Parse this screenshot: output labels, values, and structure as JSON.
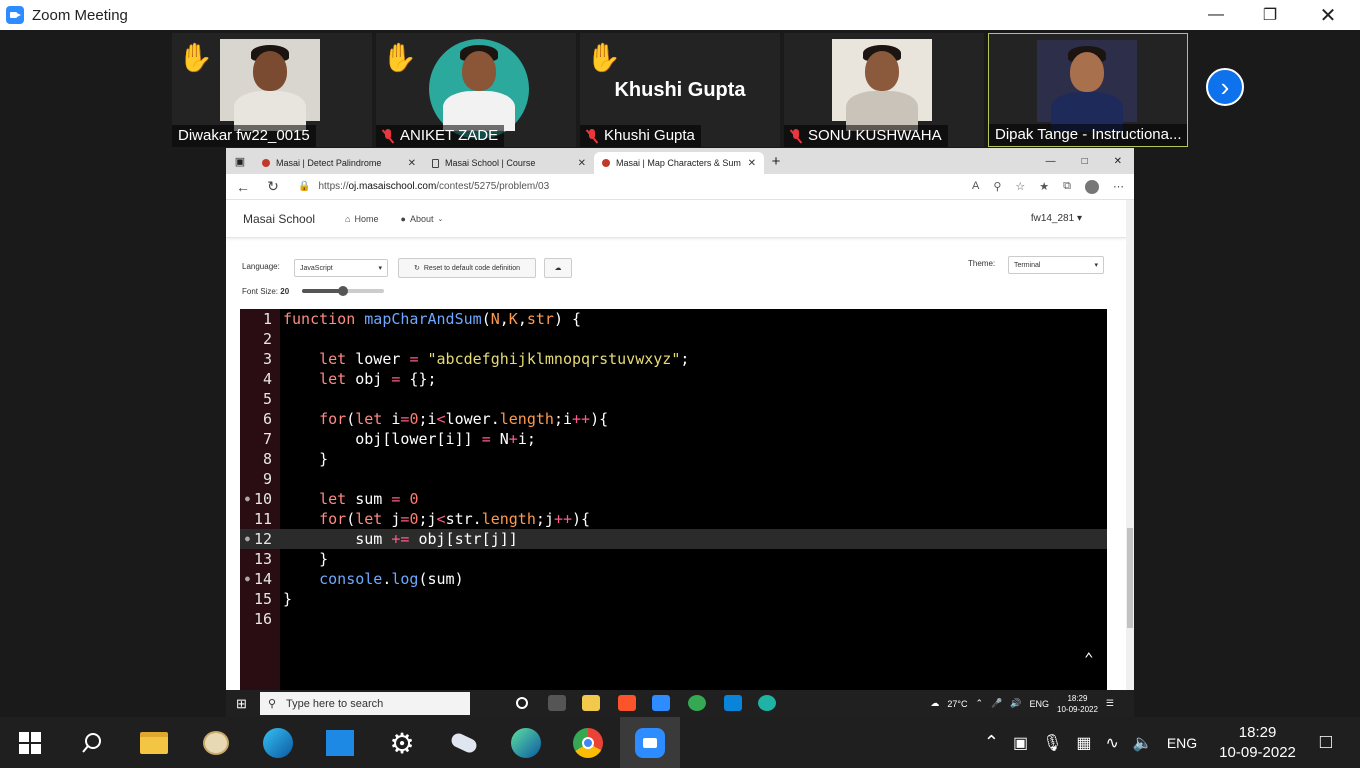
{
  "zoom": {
    "title": "Zoom Meeting",
    "participants": [
      {
        "name": "Diwakar fw22_0015",
        "hand_raised": true,
        "muted": false,
        "video": true
      },
      {
        "name": "ANIKET ZADE",
        "hand_raised": true,
        "muted": true,
        "video": true
      },
      {
        "name": "Khushi Gupta",
        "display_text": "Khushi Gupta",
        "hand_raised": true,
        "muted": true,
        "video": false
      },
      {
        "name": "SONU KUSHWAHA",
        "hand_raised": false,
        "muted": true,
        "video": true
      },
      {
        "name": "Dipak Tange - Instructiona...",
        "hand_raised": false,
        "muted": false,
        "video": true,
        "active_speaker": true
      }
    ]
  },
  "browser": {
    "tabs": [
      {
        "label": "Masai | Detect Palindrome",
        "active": false
      },
      {
        "label": "Masai School | Course",
        "active": false
      },
      {
        "label": "Masai | Map Characters & Sum",
        "active": true
      }
    ],
    "url_prefix": "https://",
    "url_domain": "oj.masaischool.com",
    "url_path": "/contest/5275/problem/03"
  },
  "site": {
    "brand": "Masai School",
    "nav": [
      {
        "label": "Home",
        "icon": "home-icon"
      },
      {
        "label": "About",
        "icon": "info-icon"
      }
    ],
    "user": "fw14_281"
  },
  "controls": {
    "language_label": "Language:",
    "language_value": "JavaScript",
    "reset_label": "Reset to default code definition",
    "theme_label": "Theme:",
    "theme_value": "Terminal",
    "font_size_label": "Font Size:",
    "font_size_value": "20",
    "font_size_slider_fraction": 0.5
  },
  "editor": {
    "highlighted_line": 12,
    "lines": [
      {
        "n": "1",
        "text": "function mapCharAndSum(N,K,str) {"
      },
      {
        "n": "2",
        "text": ""
      },
      {
        "n": "3",
        "text": "    let lower = \"abcdefghijklmnopqrstuvwxyz\";"
      },
      {
        "n": "4",
        "text": "    let obj = {};"
      },
      {
        "n": "5",
        "text": ""
      },
      {
        "n": "6",
        "text": "    for(let i=0;i<lower.length;i++){"
      },
      {
        "n": "7",
        "text": "        obj[lower[i]] = N+i;"
      },
      {
        "n": "8",
        "text": "    }"
      },
      {
        "n": "9",
        "text": ""
      },
      {
        "n": "10",
        "text": "    let sum = 0"
      },
      {
        "n": "11",
        "text": "    for(let j=0;j<str.length;j++){"
      },
      {
        "n": "12",
        "text": "        sum += obj[str[j]]"
      },
      {
        "n": "13",
        "text": "    }"
      },
      {
        "n": "14",
        "text": "    console.log(sum)"
      },
      {
        "n": "15",
        "text": "}"
      },
      {
        "n": "16",
        "text": ""
      }
    ]
  },
  "inner_taskbar": {
    "search_placeholder": "Type here to search",
    "weather": "27°C",
    "lang": "ENG",
    "time": "18:29",
    "date": "10-09-2022"
  },
  "taskbar": {
    "lang": "ENG",
    "time": "18:29",
    "date": "10-09-2022"
  },
  "colors": {
    "zoom_blue": "#0e72ed",
    "editor_bg": "#000000",
    "keyword": "#ff8a80",
    "function": "#6fa8ff",
    "string": "#e6db74"
  }
}
